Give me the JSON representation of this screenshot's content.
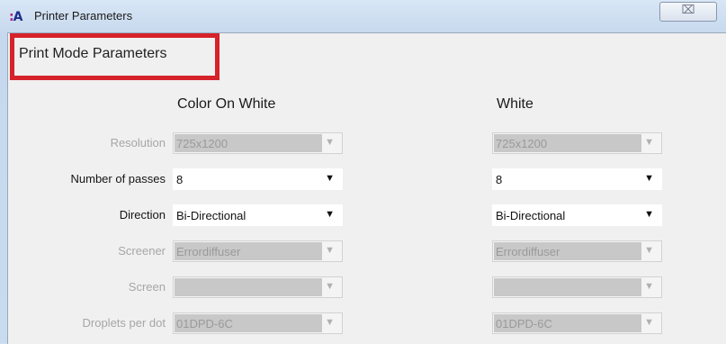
{
  "window": {
    "title": "Printer Parameters",
    "app_icon_text": "A",
    "close_glyph": "⌧"
  },
  "section_title": "Print Mode Parameters",
  "columns": {
    "left": "Color On White",
    "right": "White"
  },
  "rows": [
    {
      "label": "Resolution",
      "enabled": false,
      "left": "725x1200",
      "right": "725x1200"
    },
    {
      "label": "Number of passes",
      "enabled": true,
      "left": "8",
      "right": "8"
    },
    {
      "label": "Direction",
      "enabled": true,
      "left": "Bi-Directional",
      "right": "Bi-Directional"
    },
    {
      "label": "Screener",
      "enabled": false,
      "left": "Errordiffuser",
      "right": "Errordiffuser"
    },
    {
      "label": "Screen",
      "enabled": false,
      "left": "",
      "right": ""
    },
    {
      "label": "Droplets per dot",
      "enabled": false,
      "left": "01DPD-6C",
      "right": "01DPD-6C"
    }
  ],
  "colors": {
    "highlight": "#d6222a",
    "titlebar": "#cfe0f1",
    "dialog_bg": "#f0f0f0"
  },
  "icons": {
    "dropdown": "chevron-down-icon",
    "close": "close-icon"
  }
}
